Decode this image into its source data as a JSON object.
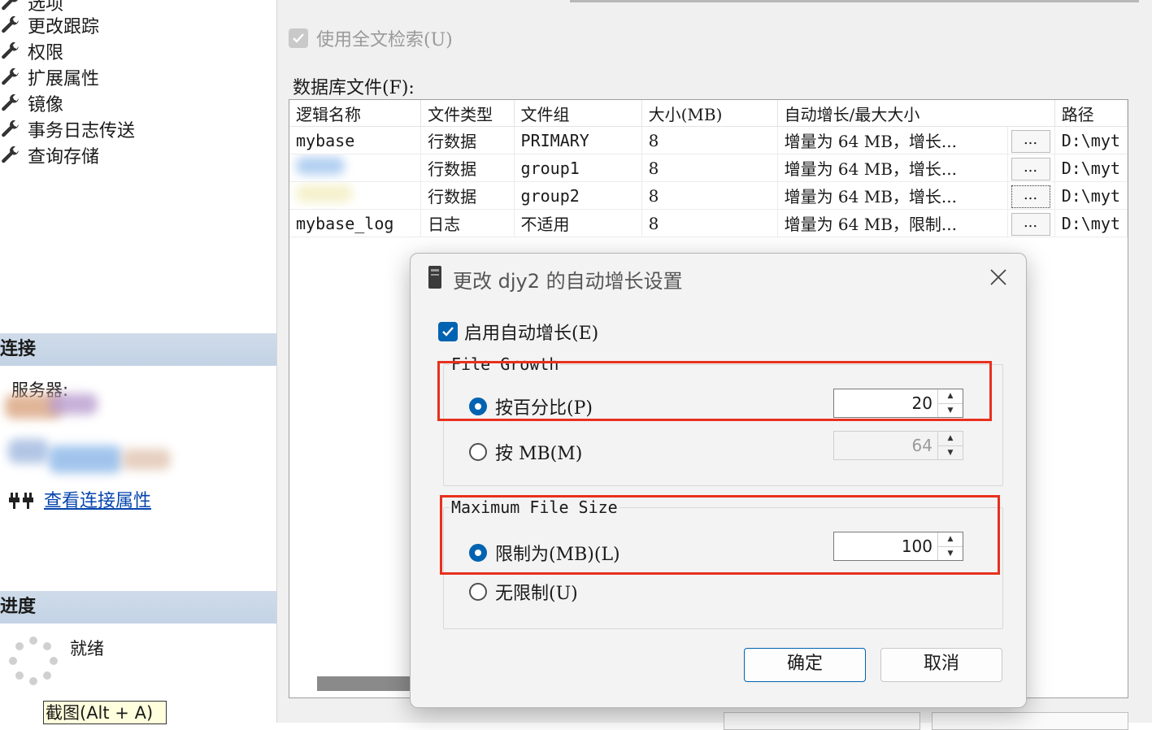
{
  "left_nav": {
    "items": [
      {
        "label": "选项",
        "icon": "wrench-icon"
      },
      {
        "label": "更改跟踪",
        "icon": "wrench-icon"
      },
      {
        "label": "权限",
        "icon": "wrench-icon"
      },
      {
        "label": "扩展属性",
        "icon": "wrench-icon"
      },
      {
        "label": "镜像",
        "icon": "wrench-icon"
      },
      {
        "label": "事务日志传送",
        "icon": "wrench-icon"
      },
      {
        "label": "查询存储",
        "icon": "wrench-icon"
      }
    ]
  },
  "connection": {
    "header": "连接",
    "server_label": "服务器:",
    "view_link": "查看连接属性"
  },
  "progress": {
    "header": "进度",
    "status": "就绪"
  },
  "screenshot_tip": "截图(Alt + A)",
  "main": {
    "fulltext_checkbox": "使用全文检索(U)",
    "files_label": "数据库文件(F):",
    "columns": [
      "逻辑名称",
      "文件类型",
      "文件组",
      "大小(MB)",
      "自动增长/最大大小",
      "路径"
    ],
    "rows": [
      {
        "name": "mybase",
        "type": "行数据",
        "group": "PRIMARY",
        "size": "8",
        "growth": "增量为 64 MB，增长...",
        "btn": "...",
        "path": "D:\\myt"
      },
      {
        "name": "",
        "type": "行数据",
        "group": "group1",
        "size": "8",
        "growth": "增量为 64 MB，增长...",
        "btn": "...",
        "path": "D:\\myt"
      },
      {
        "name": "",
        "type": "行数据",
        "group": "group2",
        "size": "8",
        "growth": "增量为 64 MB，增长...",
        "btn": "...",
        "path": "D:\\myt"
      },
      {
        "name": "mybase_log",
        "type": "日志",
        "group": "不适用",
        "size": "8",
        "growth": "增量为 64 MB，限制...",
        "btn": "...",
        "path": "D:\\myt"
      }
    ]
  },
  "dialog": {
    "title": "更改 djy2 的自动增长设置",
    "enable_autogrowth": "启用自动增长(E)",
    "file_growth_label": "File Growth",
    "by_percent": "按百分比(P)",
    "percent_value": "20",
    "by_mb": "按 MB(M)",
    "mb_value": "64",
    "max_size_label": "Maximum File Size",
    "limit_to": "限制为(MB)(L)",
    "limit_value": "100",
    "unlimited": "无限制(U)",
    "ok": "确定",
    "cancel": "取消"
  },
  "colors": {
    "accent": "#0063b1",
    "highlight_box": "#e8301e",
    "section_bar": "#c8d6e7",
    "link": "#0645ad"
  }
}
